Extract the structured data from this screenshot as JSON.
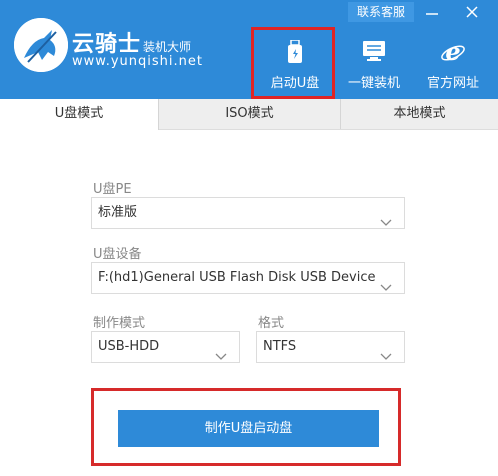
{
  "brand": {
    "name_cn": "云骑士",
    "subtitle": "装机大师",
    "url": "www.yunqishi.net"
  },
  "topbar": {
    "contact_label": "联系客服",
    "minimize_glyph": "—",
    "close_glyph": "✕"
  },
  "nav": [
    {
      "label": "启动U盘",
      "icon": "usb-drive-icon"
    },
    {
      "label": "一键装机",
      "icon": "monitor-icon"
    },
    {
      "label": "官方网址",
      "icon": "ie-browser-icon"
    }
  ],
  "tabs": [
    {
      "label": "U盘模式",
      "active": true
    },
    {
      "label": "ISO模式",
      "active": false
    },
    {
      "label": "本地模式",
      "active": false
    }
  ],
  "form": {
    "pe_label": "U盘PE",
    "pe_value": "标准版",
    "device_label": "U盘设备",
    "device_value": "F:(hd1)General USB Flash Disk USB Device",
    "mode_label": "制作模式",
    "mode_value": "USB-HDD",
    "format_label": "格式",
    "format_value": "NTFS",
    "create_button": "制作U盘启动盘"
  },
  "colors": {
    "header_blue": "#2e8ad8",
    "highlight_red": "#e02424"
  }
}
